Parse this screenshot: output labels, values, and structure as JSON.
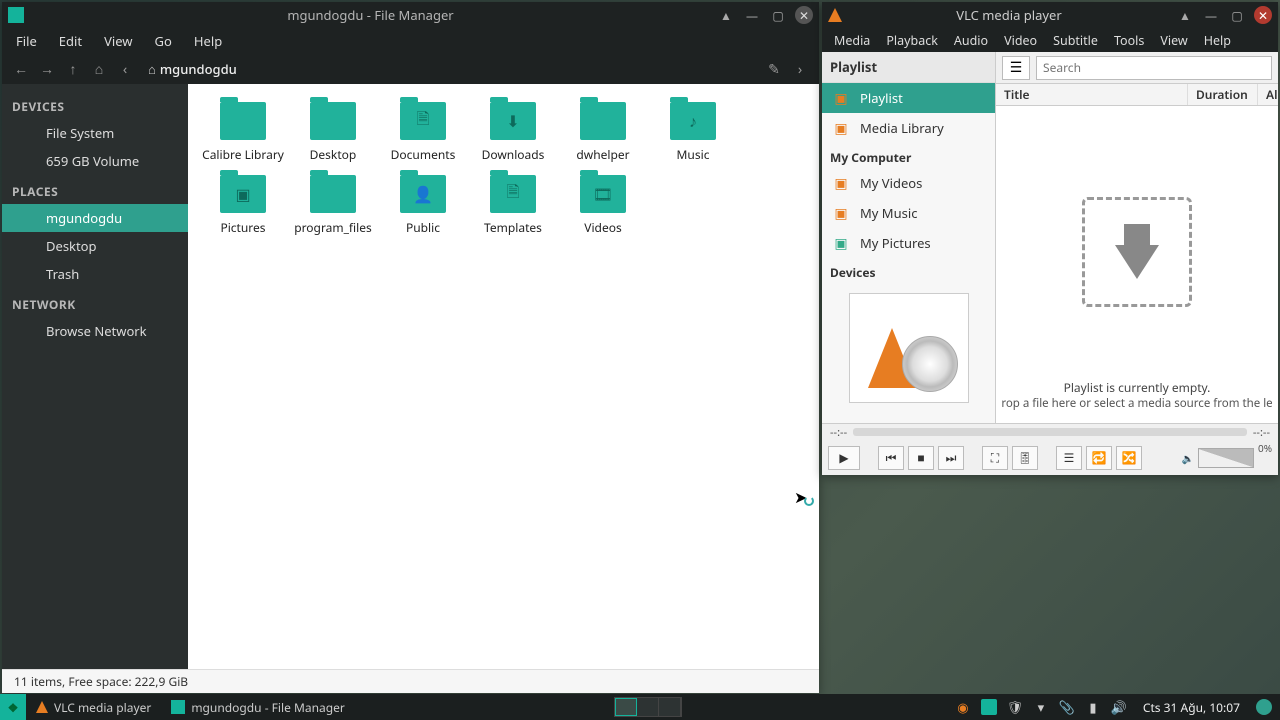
{
  "fm": {
    "title": "mgundogdu - File Manager",
    "menu": [
      "File",
      "Edit",
      "View",
      "Go",
      "Help"
    ],
    "path_name": "mgundogdu",
    "sidebar": {
      "devices_hdr": "DEVICES",
      "devices": [
        {
          "label": "File System"
        },
        {
          "label": "659 GB Volume"
        }
      ],
      "places_hdr": "PLACES",
      "places": [
        {
          "label": "mgundogdu",
          "active": true,
          "name": "sidebar-place-home"
        },
        {
          "label": "Desktop",
          "name": "sidebar-place-desktop"
        },
        {
          "label": "Trash",
          "name": "sidebar-place-trash"
        }
      ],
      "network_hdr": "NETWORK",
      "network": [
        {
          "label": "Browse Network"
        }
      ]
    },
    "folders": [
      {
        "label": "Calibre Library",
        "glyph": ""
      },
      {
        "label": "Desktop",
        "glyph": ""
      },
      {
        "label": "Documents",
        "glyph": "🗎"
      },
      {
        "label": "Downloads",
        "glyph": "⬇"
      },
      {
        "label": "dwhelper",
        "glyph": ""
      },
      {
        "label": "Music",
        "glyph": "♪"
      },
      {
        "label": "Pictures",
        "glyph": "▣"
      },
      {
        "label": "program_files",
        "glyph": ""
      },
      {
        "label": "Public",
        "glyph": "👤"
      },
      {
        "label": "Templates",
        "glyph": "🗎"
      },
      {
        "label": "Videos",
        "glyph": "🎞"
      }
    ],
    "status": "11 items, Free space: 222,9 GiB"
  },
  "vlc": {
    "title": "VLC media player",
    "menu": [
      "Media",
      "Playback",
      "Audio",
      "Video",
      "Subtitle",
      "Tools",
      "View",
      "Help"
    ],
    "left": {
      "playlist_hdr": "Playlist",
      "playlist_items": [
        {
          "label": "Playlist",
          "active": true,
          "color": "#e77d22",
          "name": "vlc-left-playlist"
        },
        {
          "label": "Media Library",
          "color": "#e77d22",
          "name": "vlc-left-medialib"
        }
      ],
      "mycomputer_hdr": "My Computer",
      "mycomputer_items": [
        {
          "label": "My Videos",
          "color": "#e77d22",
          "name": "vlc-left-myvideos"
        },
        {
          "label": "My Music",
          "color": "#e77d22",
          "name": "vlc-left-mymusic"
        },
        {
          "label": "My Pictures",
          "color": "#3a8",
          "name": "vlc-left-mypictures"
        }
      ],
      "devices_hdr": "Devices"
    },
    "right": {
      "search_placeholder": "Search",
      "col_title": "Title",
      "col_duration": "Duration",
      "col_album": "Al",
      "empty_line1": "Playlist is currently empty.",
      "empty_line2": "rop a file here or select a media source from the le"
    },
    "controls": {
      "time_left": "--:--",
      "time_right": "--:--",
      "vol_pct": "0%"
    }
  },
  "taskbar": {
    "entries": [
      {
        "label": "VLC media player",
        "icon": "cone",
        "name": "task-vlc"
      },
      {
        "label": "mgundogdu - File Manager",
        "icon": "fm",
        "name": "task-fm"
      }
    ],
    "clock": "Cts 31 Ağu, 10:07"
  }
}
